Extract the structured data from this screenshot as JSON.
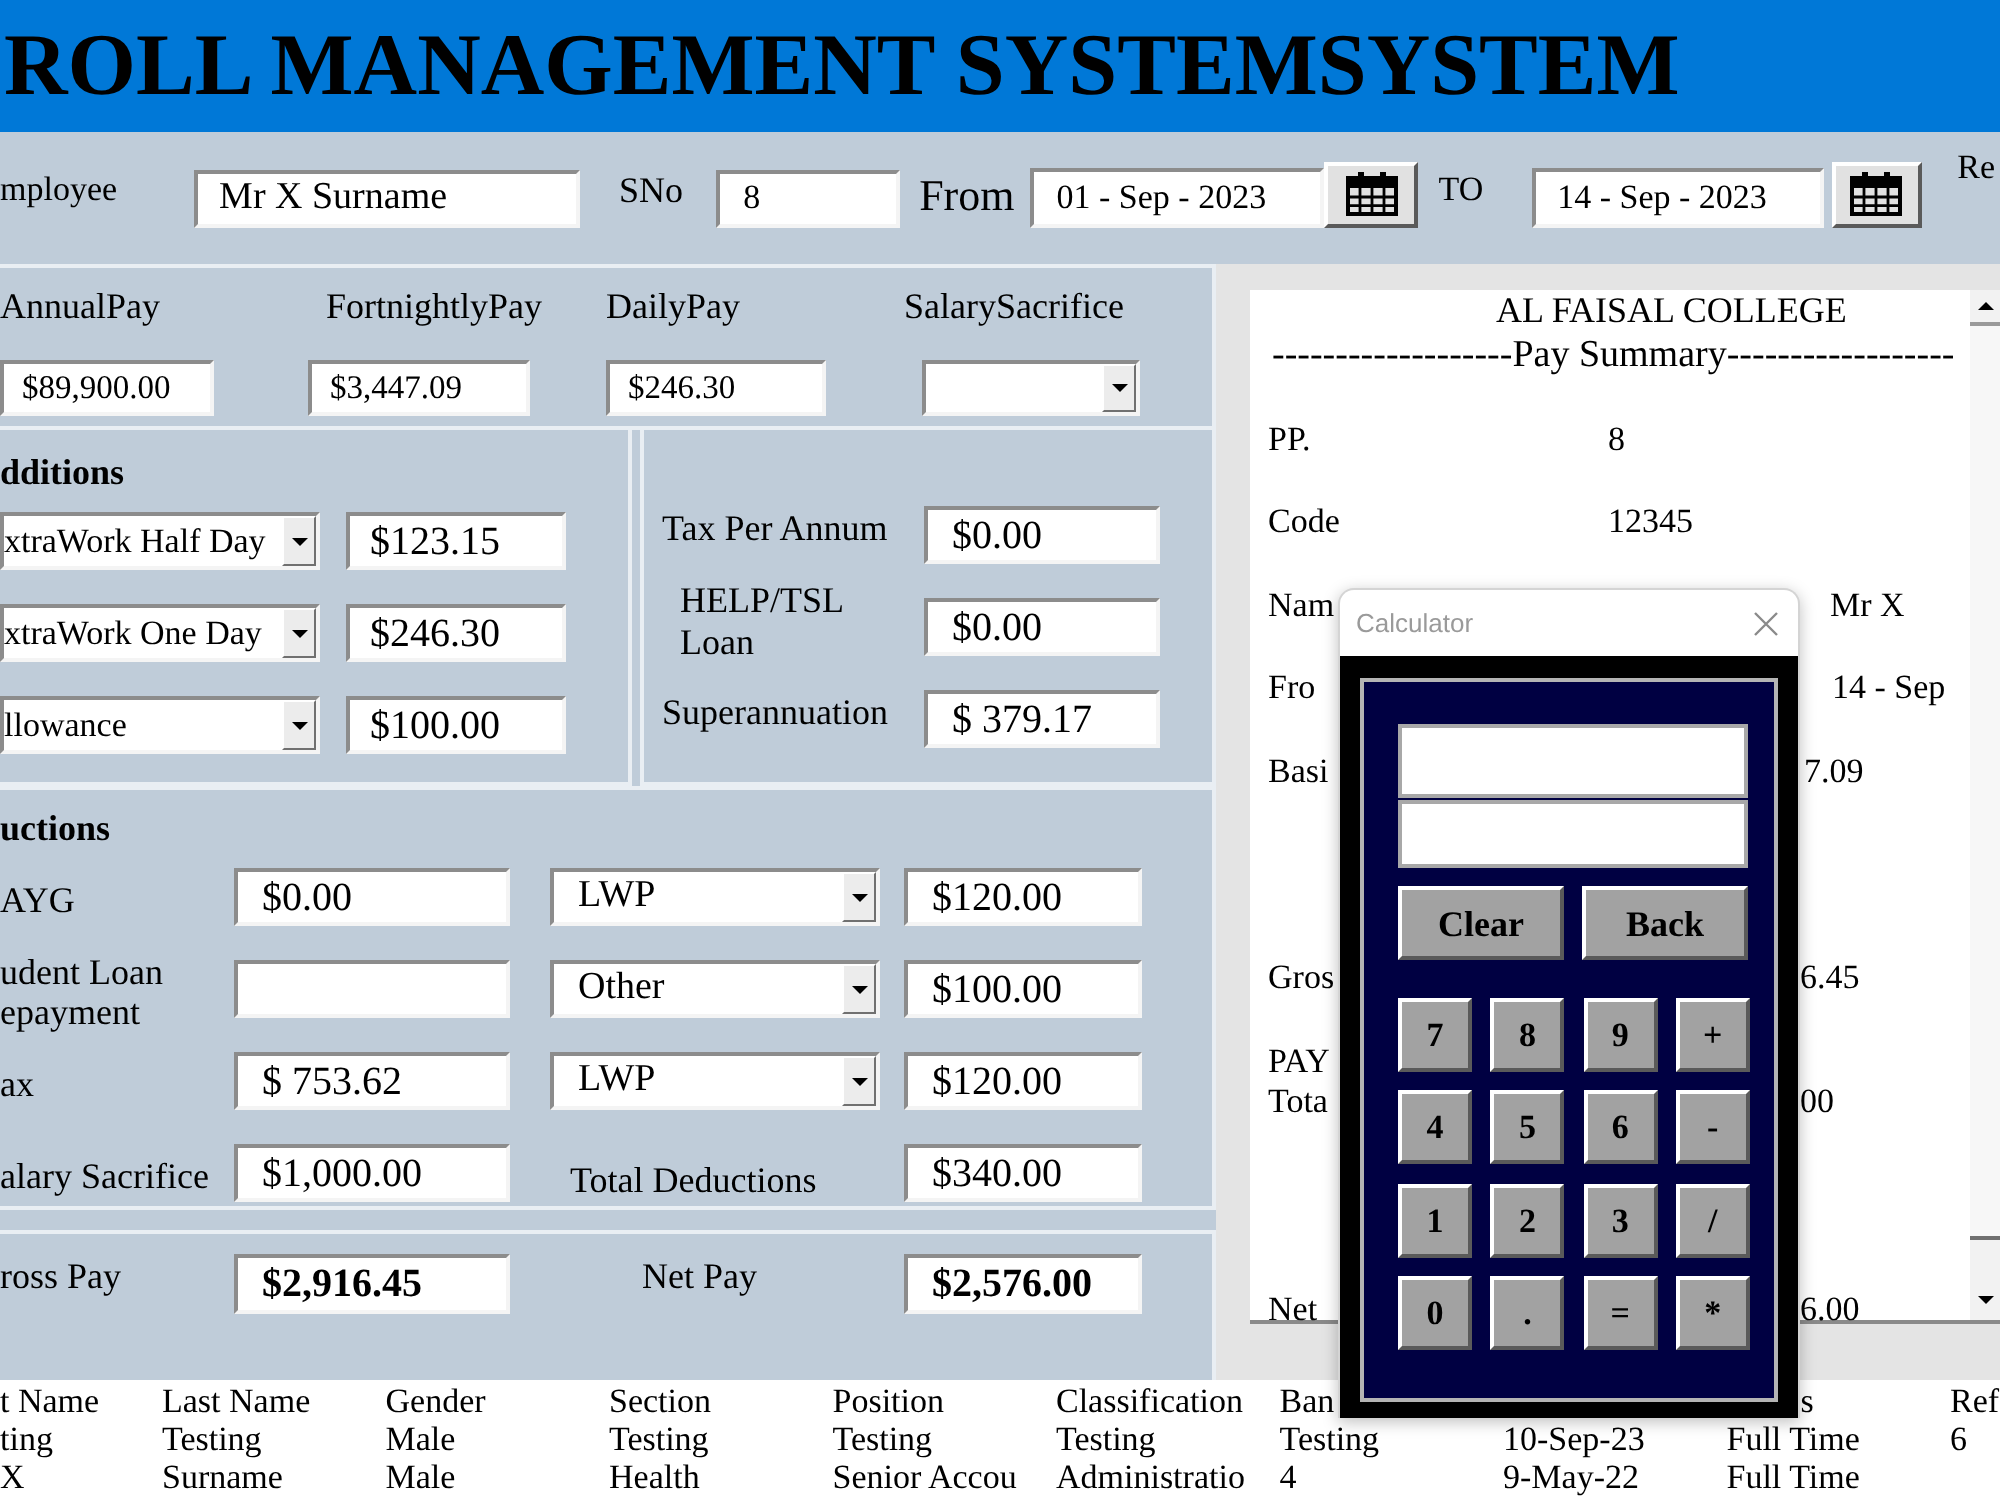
{
  "title_bar": {
    "title": "ROLL MANAGEMENT SYSTEMSYSTEM"
  },
  "toolbar": {
    "employee_label": "mployee",
    "employee": "Mr X Surname",
    "sno_label": "SNo",
    "sno": "8",
    "from_label": "From",
    "from_date": "01 - Sep - 2023",
    "to_label": "TO",
    "to_date": "14 - Sep - 2023",
    "edge_label": "Re"
  },
  "pay": [
    {
      "kind": "field",
      "label": "AnnualPay",
      "value": "$89,900.00"
    },
    {
      "kind": "field",
      "label": "FortnightlyPay",
      "value": "$3,447.09"
    },
    {
      "kind": "field",
      "label": "DailyPay",
      "value": "$246.30"
    },
    {
      "kind": "dropdown",
      "label": "SalarySacrifice"
    }
  ],
  "additions": {
    "title": "dditions",
    "rows": [
      {
        "option": "xtraWork Half Day",
        "amount": "$123.15"
      },
      {
        "option": "xtraWork One Day",
        "amount": "$246.30"
      },
      {
        "option": "llowance",
        "amount": "$100.00"
      }
    ]
  },
  "tax": [
    {
      "label": "Tax Per Annum",
      "value": "$0.00"
    },
    {
      "label": "HELP/TSL\nLoan",
      "value": "$0.00"
    },
    {
      "label": "Superannuation",
      "value": "$ 379.17"
    }
  ],
  "deductions": {
    "title": "uctions",
    "rows": [
      {
        "kind": "dropdown",
        "label": "AYG",
        "value": "$0.00",
        "option": "LWP",
        "amount": "$120.00"
      },
      {
        "kind": "dropdown",
        "label": "udent Loan\nepayment",
        "option": "Other",
        "amount": "$100.00"
      },
      {
        "kind": "dropdown",
        "label": "ax",
        "value": "$ 753.62",
        "option": "LWP",
        "amount": "$120.00"
      },
      {
        "kind": "total",
        "label": "alary Sacrifice",
        "value": "$1,000.00",
        "total_label": "Total Deductions",
        "amount": "$340.00"
      }
    ]
  },
  "totals": {
    "gross_label": "ross Pay",
    "gross": "$2,916.45",
    "net_label": "Net Pay",
    "net": "$2,576.00"
  },
  "pay_summary": {
    "title": "AL FAISAL COLLEGE",
    "subtitle": "-------------------Pay Summary------------------",
    "rows": [
      {
        "label": "PP.",
        "value": "8"
      },
      {
        "label": "Code",
        "value": "12345"
      },
      {
        "label": "Nam",
        "value": "Mr X"
      },
      {
        "label": "Fro",
        "value": "14 - Sep"
      },
      {
        "label": "Basi",
        "value": "7.09"
      },
      {
        "label": "Gros",
        "value": "6.45"
      },
      {
        "label": "PAY"
      },
      {
        "label": "Tota",
        "value": "00"
      },
      {
        "label": "Net",
        "value": "6.00"
      }
    ]
  },
  "calculator": {
    "title": "Calculator",
    "actions": [
      "Clear",
      "Back"
    ],
    "keys": [
      "7",
      "8",
      "9",
      "+",
      "4",
      "5",
      "6",
      "-",
      "1",
      "2",
      "3",
      "/",
      "0",
      ".",
      "=",
      "*"
    ]
  },
  "table": {
    "columns": [
      "t Name",
      "Last Name",
      "Gender",
      "Section",
      "Position",
      "Classification",
      "Ban",
      null,
      "s",
      "Ref"
    ],
    "rows": [
      [
        "ting",
        "Testing",
        "Male",
        "Testing",
        "Testing",
        "Testing",
        "Testing",
        "10-Sep-23",
        "Full Time",
        "6"
      ],
      [
        "X",
        "Surname",
        "Male",
        "Health",
        "Senior Accou",
        "Administratio",
        "4",
        "9-May-22",
        "Full Time"
      ]
    ]
  }
}
